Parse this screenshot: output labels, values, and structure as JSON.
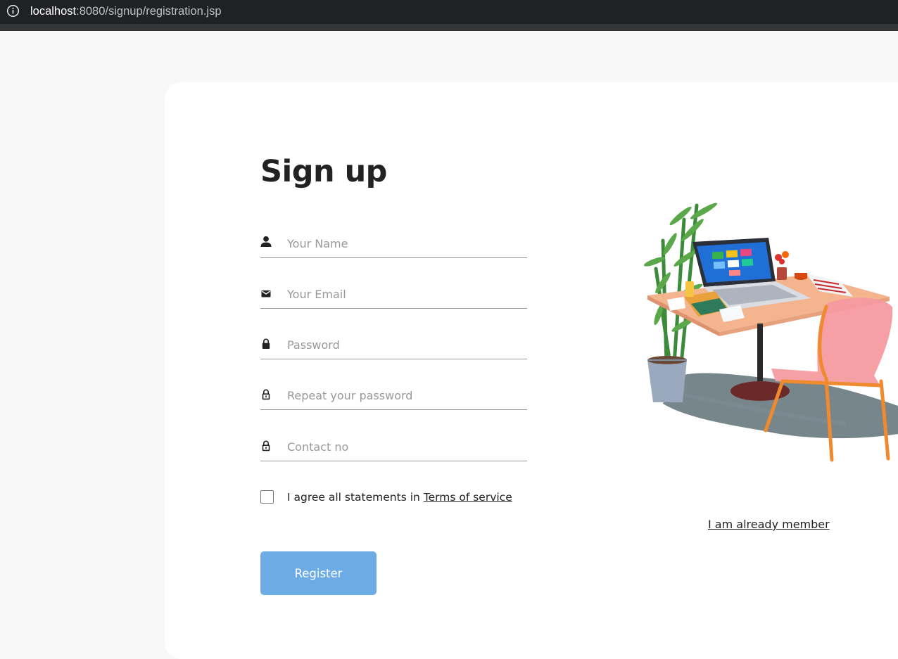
{
  "browser": {
    "url_host": "localhost",
    "url_path": ":8080/signup/registration.jsp"
  },
  "form": {
    "title": "Sign up",
    "fields": [
      {
        "placeholder": "Your Name",
        "icon": "person-icon"
      },
      {
        "placeholder": "Your Email",
        "icon": "email-icon"
      },
      {
        "placeholder": "Password",
        "icon": "lock-icon"
      },
      {
        "placeholder": "Repeat your password",
        "icon": "lock-outline-icon"
      },
      {
        "placeholder": "Contact no",
        "icon": "lock-outline-icon"
      }
    ],
    "agree_text": "I agree all statements in ",
    "terms_link": "Terms of service",
    "register_label": "Register",
    "member_link": "I am already member"
  },
  "colors": {
    "button": "#6dabe4",
    "background": "#f8f8f8",
    "card": "#ffffff"
  }
}
